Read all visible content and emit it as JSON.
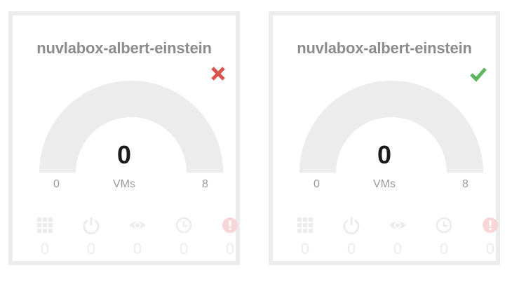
{
  "cards": [
    {
      "title": "nuvlabox-albert-einstein",
      "status": "offline",
      "status_icon": "x-icon",
      "status_color": "#d9534f",
      "gauge": {
        "value": 0,
        "unit": "VMs",
        "min": 0,
        "max": 8
      },
      "stats": [
        {
          "icon": "grid-icon",
          "value": "0"
        },
        {
          "icon": "power-icon",
          "value": "0"
        },
        {
          "icon": "eye-icon",
          "value": "0"
        },
        {
          "icon": "clock-icon",
          "value": "0"
        },
        {
          "icon": "alert-icon",
          "value": "0"
        }
      ]
    },
    {
      "title": "nuvlabox-albert-einstein",
      "status": "online",
      "status_icon": "check-icon",
      "status_color": "#5cb85c",
      "gauge": {
        "value": 0,
        "unit": "VMs",
        "min": 0,
        "max": 8
      },
      "stats": [
        {
          "icon": "grid-icon",
          "value": "0"
        },
        {
          "icon": "power-icon",
          "value": "0"
        },
        {
          "icon": "eye-icon",
          "value": "0"
        },
        {
          "icon": "clock-icon",
          "value": "0"
        },
        {
          "icon": "alert-icon",
          "value": "0"
        }
      ]
    }
  ],
  "colors": {
    "gauge_track": "#ececec",
    "stat_icon": "#ececec",
    "alert_icon": "#f6d6d6"
  }
}
